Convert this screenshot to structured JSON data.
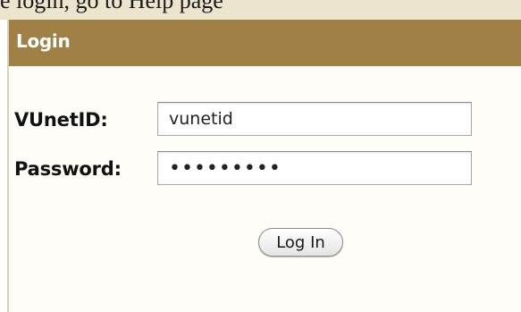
{
  "page_top": {
    "partial_text": "e login, go to Help page"
  },
  "login_panel": {
    "title": "Login",
    "vunetid_label": "VUnetID:",
    "vunetid_value": "vunetid",
    "password_label": "Password:",
    "password_value": "•••••••••",
    "login_button_label": "Log In"
  },
  "colors": {
    "header_background": "#a08045",
    "header_text": "#ffffff",
    "top_strip_background": "#ede4cd",
    "panel_background": "#fffdf8"
  }
}
